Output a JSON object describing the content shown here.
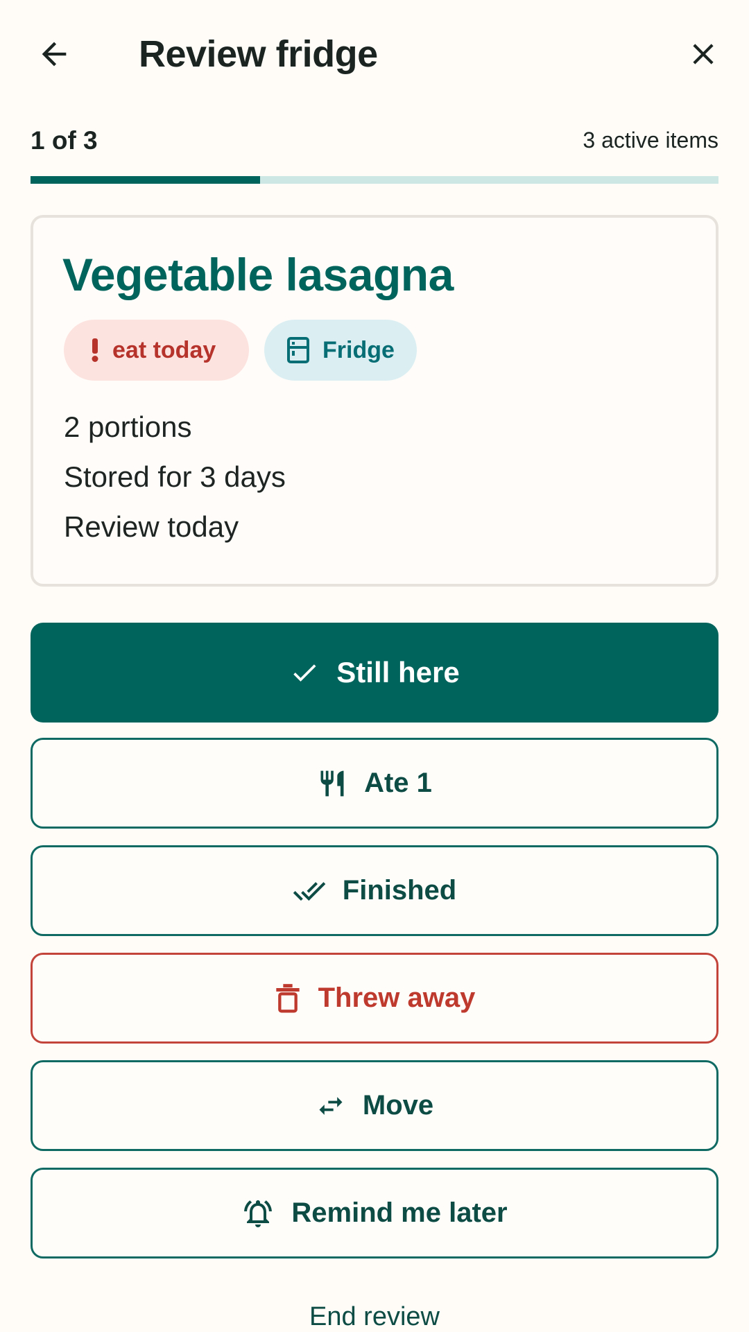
{
  "header": {
    "title": "Review fridge"
  },
  "progress": {
    "step_label": "1 of 3",
    "active_items": "3 active items",
    "current": 1,
    "total": 3
  },
  "item": {
    "name": "Vegetable lasagna",
    "chips": [
      {
        "label": "eat today",
        "icon": "exclamation-icon",
        "color": "#b5332b"
      },
      {
        "label": "Fridge",
        "icon": "fridge-icon",
        "color": "#066e74"
      }
    ],
    "details": [
      "2 portions",
      "Stored for 3 days",
      "Review today"
    ]
  },
  "actions": {
    "still_here": "Still here",
    "ate_one": "Ate 1",
    "finished": "Finished",
    "threw_away": "Threw away",
    "move": "Move",
    "remind_later": "Remind me later"
  },
  "footer": {
    "end_review": "End review"
  },
  "colors": {
    "primary": "#00635c",
    "danger": "#c2443b",
    "background": "#fffbf7",
    "track": "#cde8e4"
  }
}
